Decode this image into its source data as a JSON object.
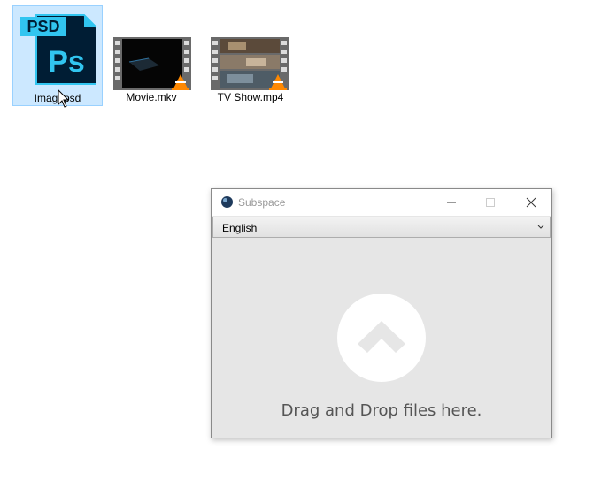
{
  "desktop": {
    "files": [
      {
        "label": "Imag  .psd",
        "icon": "photoshop-file-icon",
        "badge_text": "PSD",
        "logo_text": "Ps",
        "selected": true
      },
      {
        "label": "Movie.mkv",
        "icon": "vlc-video-file-icon",
        "selected": false
      },
      {
        "label": "TV Show.mp4",
        "icon": "vlc-video-file-icon",
        "selected": false
      }
    ]
  },
  "window": {
    "title": "Subspace",
    "language": {
      "selected": "English"
    },
    "drop_zone": {
      "text": "Drag and Drop files here.",
      "icon": "upload-arrow-icon"
    }
  },
  "colors": {
    "selection_bg": "#cce8ff",
    "psd_blue": "#31c5f0",
    "psd_dark": "#001d34",
    "vlc_orange": "#ff8800",
    "window_bg": "#e6e6e6"
  }
}
